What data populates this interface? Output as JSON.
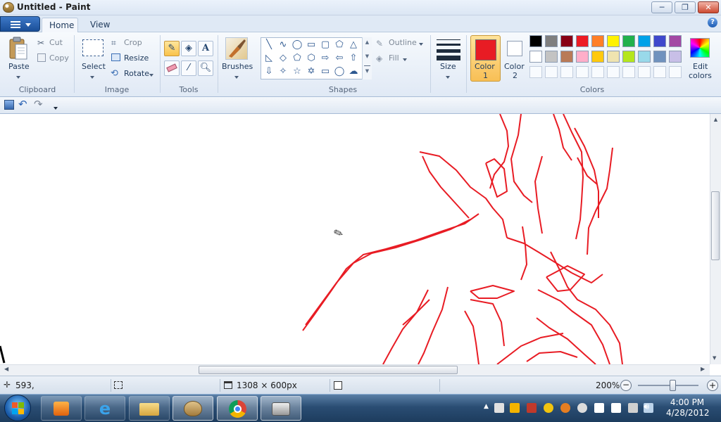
{
  "window": {
    "title": "Untitled - Paint"
  },
  "tabs": [
    {
      "label": "Home"
    },
    {
      "label": "View"
    }
  ],
  "ribbon": {
    "clipboard": {
      "paste": "Paste",
      "cut": "Cut",
      "copy": "Copy",
      "group": "Clipboard"
    },
    "image": {
      "select": "Select",
      "crop": "Crop",
      "resize": "Resize",
      "rotate": "Rotate",
      "group": "Image"
    },
    "tools": {
      "group": "Tools"
    },
    "brushes": {
      "label": "Brushes"
    },
    "shapes": {
      "outline": "Outline",
      "fill": "Fill",
      "group": "Shapes"
    },
    "size": {
      "label": "Size"
    },
    "colors": {
      "color1_label": "Color",
      "color1_num": "1",
      "color2_label": "Color",
      "color2_num": "2",
      "color1": "#e81c24",
      "color2": "#ffffff",
      "edit_label": "Edit",
      "edit_label2": "colors",
      "group": "Colors",
      "palette_row1": [
        "#000000",
        "#7f7f7f",
        "#880015",
        "#ed1c24",
        "#ff7f27",
        "#fff200",
        "#22b14c",
        "#00a2e8",
        "#3f48cc",
        "#a349a4"
      ],
      "palette_row2": [
        "#ffffff",
        "#c3c3c3",
        "#b97a57",
        "#ffaec9",
        "#ffc90e",
        "#efe4b0",
        "#b5e61d",
        "#99d9ea",
        "#7092be",
        "#c8bfe7"
      ]
    }
  },
  "status": {
    "cursor_pos": "593,",
    "canvas_size": "1308 × 600px",
    "zoom": "200%"
  },
  "taskbar": {
    "time": "4:00 PM",
    "date": "4/28/2012"
  }
}
